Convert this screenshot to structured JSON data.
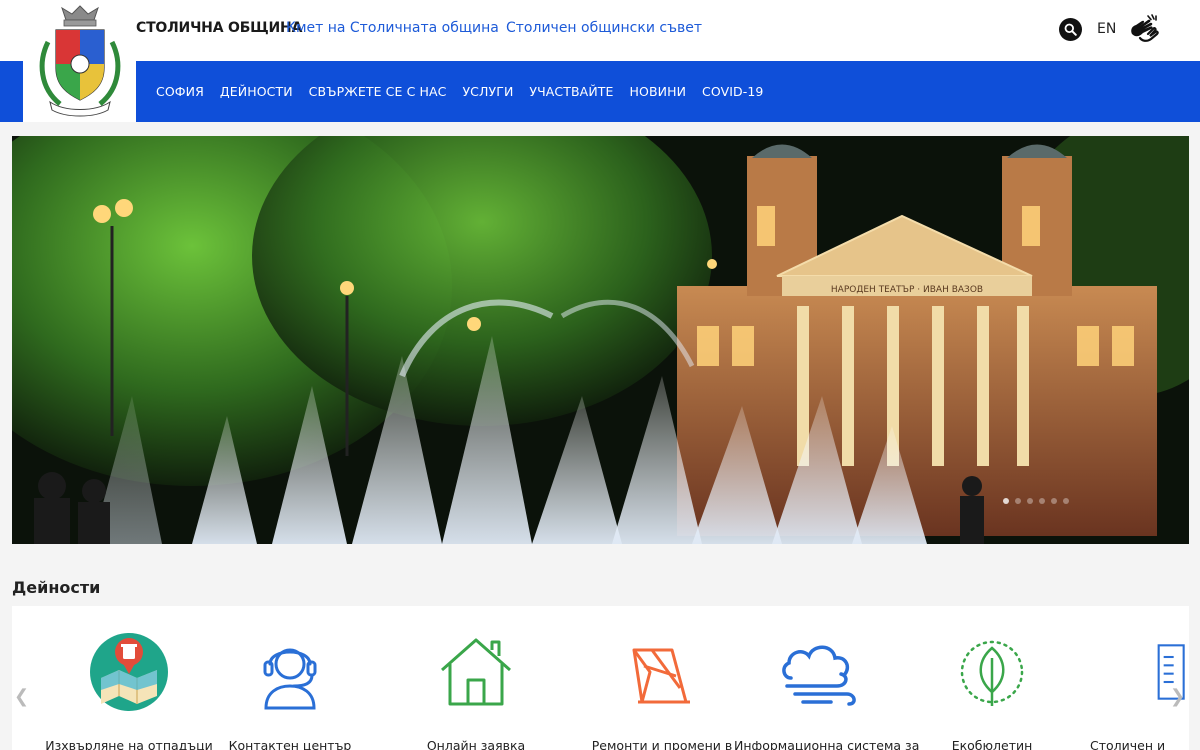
{
  "header": {
    "brand": "СТОЛИЧНА ОБЩИНА",
    "links": [
      {
        "label": "Кмет на Столичната община"
      },
      {
        "label": "Столичен общински съвет"
      }
    ],
    "lang": "EN",
    "icons": [
      "search-icon",
      "sign-language-icon"
    ]
  },
  "nav": {
    "items": [
      "СОФИЯ",
      "ДЕЙНОСТИ",
      "СВЪРЖЕТЕ СЕ С НАС",
      "УСЛУГИ",
      "УЧАСТВАЙТЕ",
      "НОВИНИ",
      "COVID-19"
    ]
  },
  "hero": {
    "building_text": "НАРОДЕН ТЕАТЪР · ИВАН ВАЗОВ"
  },
  "activities": {
    "title": "Дейности",
    "cards": [
      {
        "label": "Изхвърляне на отпадъци",
        "icon": "waste-map-icon"
      },
      {
        "label": "Контактен център",
        "icon": "headset-icon"
      },
      {
        "label": "Онлайн заявка",
        "icon": "house-icon"
      },
      {
        "label": "Ремонти и промени в",
        "icon": "road-barrier-icon"
      },
      {
        "label": "Информационна система за",
        "icon": "cloud-wind-icon"
      },
      {
        "label": "Екобюлетин",
        "icon": "leaf-icon"
      },
      {
        "label": "Столичен и",
        "icon": "document-icon"
      }
    ]
  },
  "colors": {
    "nav_blue": "#0f4fd9",
    "link_blue": "#1e5bd8",
    "icon_blue": "#2a6fd6",
    "icon_green": "#3aa64a",
    "icon_orange": "#f26a3a"
  }
}
